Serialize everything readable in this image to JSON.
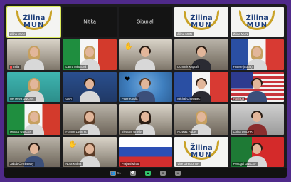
{
  "tiles": [
    {
      "name": "Žilina MUN",
      "center": "",
      "type": "logo",
      "logo_l1": "Žilina",
      "logo_l2": "MUN",
      "active": true
    },
    {
      "name": "",
      "center": "Nitika",
      "type": "blank"
    },
    {
      "name": "",
      "center": "Gitanjali",
      "type": "blank"
    },
    {
      "name": "Žilina MUN",
      "center": "",
      "type": "logo",
      "logo_l1": "Žilina",
      "logo_l2": "MUN"
    },
    {
      "name": "Žilina MUN",
      "center": "",
      "type": "logo",
      "logo_l1": "Žilina",
      "logo_l2": "MUN"
    },
    {
      "name": "India",
      "center": "",
      "type": "person",
      "bg": "bg-room2",
      "person": "long blonde light",
      "mic_off": true
    },
    {
      "name": "Laura Minatová",
      "center": "",
      "type": "person",
      "bg": "bg-italy",
      "person": "long blonde light"
    },
    {
      "name": "",
      "center": "",
      "type": "person",
      "bg": "bg-room2",
      "person": "dark light",
      "emoji": "✋"
    },
    {
      "name": "Dominik Kapraň",
      "center": "",
      "type": "person",
      "bg": "bg-room",
      "person": "dark"
    },
    {
      "name": "France (Lucia)",
      "center": "",
      "type": "person",
      "bg": "bg-france",
      "person": "long blonde light"
    },
    {
      "name": "UK Meva UNCHR",
      "center": "",
      "type": "person",
      "bg": "bg-teal",
      "person": "long blonde light"
    },
    {
      "name": "USA",
      "center": "",
      "type": "person",
      "bg": "bg-blue",
      "person": "dark light"
    },
    {
      "name": "Peter Kocák",
      "center": "",
      "type": "person",
      "bg": "bg-un",
      "person": "blue",
      "emoji": "❤"
    },
    {
      "name": "Michal Chovanec",
      "center": "",
      "type": "person",
      "bg": "bg-france",
      "person": "dark"
    },
    {
      "name": "Haninga",
      "center": "",
      "type": "person",
      "bg": "bg-usa",
      "person": "dark blue"
    },
    {
      "name": "Mexico UNICEF",
      "center": "",
      "type": "person",
      "bg": "bg-italy",
      "person": "long blonde light"
    },
    {
      "name": "France Lucie H.",
      "center": "",
      "type": "person",
      "bg": "bg-room",
      "person": "long light"
    },
    {
      "name": "Vietnam Unelly",
      "center": "",
      "type": "person",
      "bg": "bg-room2",
      "person": "long dark light"
    },
    {
      "name": "Norway, Adbel",
      "center": "",
      "type": "person",
      "bg": "bg-room",
      "person": "long blonde light"
    },
    {
      "name": "China UNCHR",
      "center": "",
      "type": "person",
      "bg": "bg-chn",
      "person": "dark red"
    },
    {
      "name": "Jakub Černianský",
      "center": "",
      "type": "person",
      "bg": "bg-room",
      "person": "dark blue"
    },
    {
      "name": "Nora Kalina",
      "center": "",
      "type": "person",
      "bg": "bg-room2",
      "person": "long light",
      "emoji": "✋"
    },
    {
      "name": "Prajwal Mhat",
      "center": "",
      "type": "flag",
      "bg": "bg-russia"
    },
    {
      "name": "Vice Director DF",
      "center": "",
      "type": "logo",
      "logo_l1": "Žilina",
      "logo_l2": "MUN"
    },
    {
      "name": "Portugal UNICEF",
      "center": "",
      "type": "person",
      "bg": "bg-portugal",
      "person": "dark light"
    }
  ],
  "toolbar": {
    "participants_count": "51",
    "icons": [
      "participants-icon",
      "chat-icon",
      "share-screen-icon",
      "record-icon",
      "reactions-icon"
    ]
  }
}
